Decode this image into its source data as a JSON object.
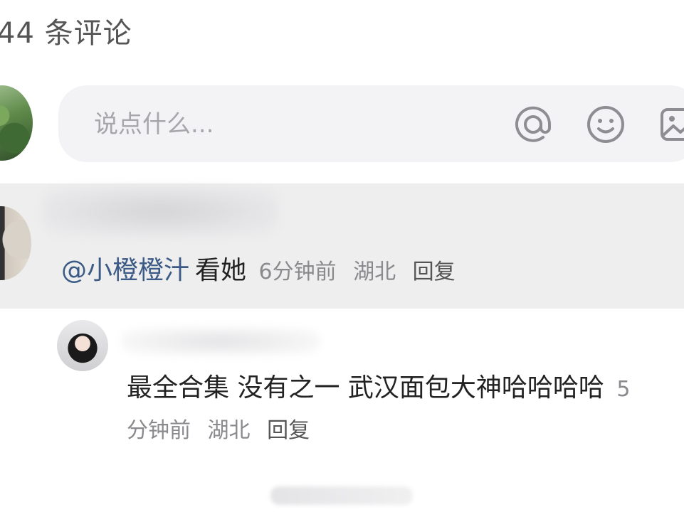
{
  "header": {
    "comment_count": "44 条评论"
  },
  "composer": {
    "placeholder": "说点什么...",
    "icons": [
      "at-icon",
      "emoji-icon",
      "image-icon"
    ]
  },
  "comments": [
    {
      "mention": "@小橙橙汁",
      "text": "看她",
      "time": "6分钟前",
      "location": "湖北",
      "reply": "回复",
      "highlighted": true
    },
    {
      "text": "最全合集 没有之一 武汉面包大神哈哈哈哈",
      "time": "5分钟前",
      "location": "湖北",
      "reply": "回复"
    }
  ],
  "colors": {
    "mention": "#3b5b86",
    "meta": "#8a8a8e",
    "highlight_bg": "#eeeeef",
    "composer_bg": "#f3f3f5"
  }
}
